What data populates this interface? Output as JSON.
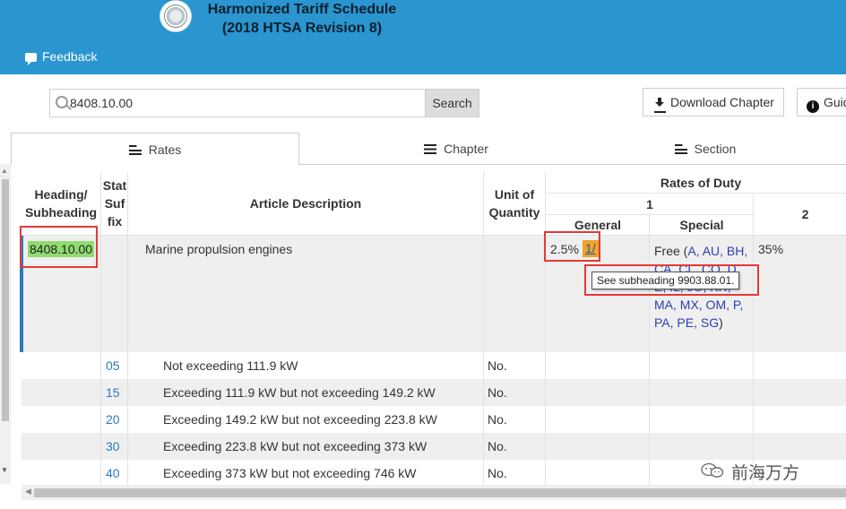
{
  "header": {
    "title_line1": "Harmonized Tariff Schedule",
    "title_line2": "(2018 HTSA Revision 8)",
    "feedback_label": "Feedback"
  },
  "search": {
    "value": "8408.10.00",
    "button_label": "Search"
  },
  "toolbar": {
    "download_label": "Download Chapter",
    "guide_label": "Guide"
  },
  "tabs": [
    {
      "label": "Rates",
      "active": true
    },
    {
      "label": "Chapter",
      "active": false
    },
    {
      "label": "Section",
      "active": false
    }
  ],
  "table": {
    "headers": {
      "heading": "Heading/ Subheading",
      "stat_suffix": "Stat Suf fix",
      "description": "Article Description",
      "unit": "Unit of Quantity",
      "rates_of_duty": "Rates of Duty",
      "col1": "1",
      "general": "General",
      "special": "Special",
      "col2": "2"
    },
    "main_row": {
      "heading": "8408.10.00",
      "description": "Marine propulsion engines",
      "general": "2.5%",
      "footnote": "1/",
      "special_prefix": "Free (",
      "special_codes": "A, AU, BH, CA, CL, CO, D, E, IL, JO, KR, MA, MX, OM, P, PA, PE, SG",
      "special_suffix": ")",
      "col2": "35%"
    },
    "tooltip": "See subheading 9903.88.01.",
    "rows": [
      {
        "suffix": "05",
        "description": "Not exceeding 111.9 kW",
        "unit": "No."
      },
      {
        "suffix": "15",
        "description": "Exceeding 111.9 kW but not exceeding 149.2 kW",
        "unit": "No."
      },
      {
        "suffix": "20",
        "description": "Exceeding 149.2 kW but not exceeding 223.8 kW",
        "unit": "No."
      },
      {
        "suffix": "30",
        "description": "Exceeding 223.8 kW but not exceeding 373 kW",
        "unit": "No."
      },
      {
        "suffix": "40",
        "description": "Exceeding 373 kW but not exceeding 746 kW",
        "unit": "No."
      }
    ]
  },
  "watermark": "前海万方",
  "colors": {
    "header_bg": "#2a95cf",
    "highlight_green": "#8fdc70",
    "footnote_orange": "#f0a42b",
    "annotation_red": "#e53935",
    "link_blue": "#2a7bbf"
  }
}
